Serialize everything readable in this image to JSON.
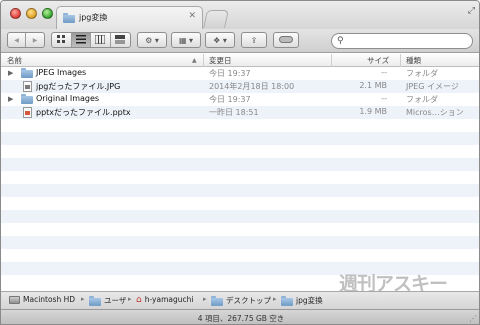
{
  "window": {
    "tab_title": "jpg変換",
    "tab_close": "✕"
  },
  "toolbar": {
    "back": "◀",
    "forward": "▶",
    "search_placeholder": ""
  },
  "columns": {
    "name": "名前",
    "date": "変更日",
    "size": "サイズ",
    "kind": "種類"
  },
  "rows": [
    {
      "type": "folder",
      "name": "JPEG Images",
      "date": "今日 19:37",
      "size": "--",
      "kind": "フォルダ"
    },
    {
      "type": "jpg",
      "name": "jpgだったファイル.JPG",
      "date": "2014年2月18日 18:00",
      "size": "2.1 MB",
      "kind": "JPEG イメージ"
    },
    {
      "type": "folder",
      "name": "Original Images",
      "date": "今日 19:37",
      "size": "--",
      "kind": "フォルダ"
    },
    {
      "type": "pptx",
      "name": "pptxだったファイル.pptx",
      "date": "一昨日 18:51",
      "size": "1.9 MB",
      "kind": "Micros…ション"
    }
  ],
  "pathbar": [
    "Macintosh HD",
    "ユーザ",
    "h-yamaguchi",
    "デスクトップ",
    "jpg変換"
  ],
  "status": "4 項目、267.75 GB 空き",
  "watermark": "週刊アスキー"
}
